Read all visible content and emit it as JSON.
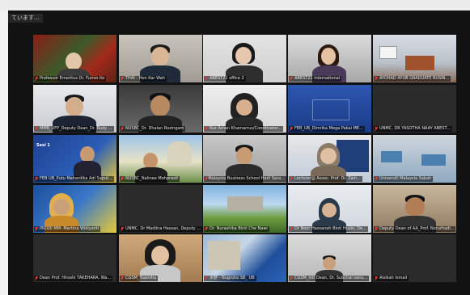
{
  "window": {
    "banner": "ています..."
  },
  "tiles": [
    {
      "name": "Professor Emeritus Dr. Fumio Ito",
      "muted": true
    },
    {
      "name": "THAI - Hen Kar Wah",
      "muted": true
    },
    {
      "name": "ABEST21 office 2",
      "muted": true,
      "active": true
    },
    {
      "name": "ABEST21 International",
      "muted": true
    },
    {
      "name": "AYOHAD AYUB GRADUATE BUSIN...",
      "muted": true
    },
    {
      "name": "MMB_UFP_Deputy Dean_Dr. Rudy ...",
      "muted": true
    },
    {
      "name": "NUSBC_Dr. Dhalan Rozingam",
      "muted": true
    },
    {
      "name": "Nur Aman Khamarrus/Coordinator...",
      "muted": true
    },
    {
      "name": "FEB_UB_Dimrika Mega Pakai ME...",
      "muted": true
    },
    {
      "name": "UNMC, DR YASOTHA NAAY ABEST...",
      "muted": true
    },
    {
      "name": "FEB UB_Putu Mahardika Adi Saput...",
      "muted": true,
      "poster_title": "Sesi 1"
    },
    {
      "name": "NUSBC_Nalinee Mohprasit",
      "muted": true
    },
    {
      "name": "Malaysia Business School Hairi Sara...",
      "muted": true
    },
    {
      "name": "Lecturer@ Assoc. Prof. Dr. Zain...",
      "muted": true
    },
    {
      "name": "Universiti Malaysia Sabah",
      "muted": true
    },
    {
      "name": "PRODI MM- Martina Widiyanti",
      "muted": true
    },
    {
      "name": "UNMC, Dr Madlina Hassan, Deputy ...",
      "muted": true
    },
    {
      "name": "Dr. Nurashika Binti Che Nawi",
      "muted": true
    },
    {
      "name": "Dr Noor Hassanah Binti Husin, De...",
      "muted": true
    },
    {
      "name": "Deputy Dean of AA_Prof. Norurhadi...",
      "muted": true
    },
    {
      "name": "Dean Prof. Hiroshi TAKEHARA, Wa...",
      "muted": true
    },
    {
      "name": "CGSM_Yuanshu",
      "muted": true
    },
    {
      "name": "水野 - Nugroho SB_ UB",
      "muted": true
    },
    {
      "name": "CGSM_Intl Dean, Dr. Subchai sanu...",
      "muted": true
    },
    {
      "name": "Aisikah Ismail",
      "muted": true
    }
  ],
  "colors": {
    "mute_icon": "#e0413a",
    "active_border": "#c7d94a"
  }
}
